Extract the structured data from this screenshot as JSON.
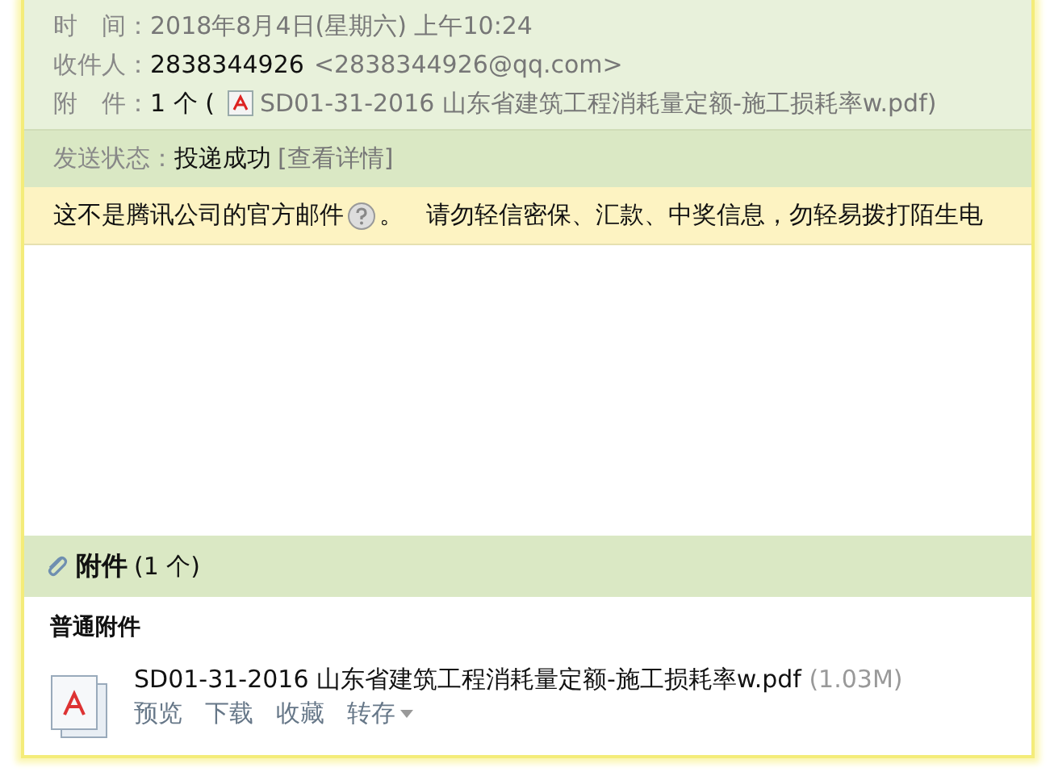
{
  "header": {
    "fields": [
      {
        "label": "时　间：",
        "value": "2018年8月4日(星期六) 上午10:24",
        "kind": "time"
      },
      {
        "label": "收件人：",
        "value": "2838344926",
        "address": "<2838344926@qq.com>",
        "kind": "recipient"
      },
      {
        "label": "附　件：",
        "value": "1 个 (",
        "file": "SD01-31-2016 山东省建筑工程消耗量定额-施工损耗率w.pdf)",
        "kind": "attachment"
      }
    ]
  },
  "status": {
    "label": "发送状态：",
    "value": "投递成功",
    "link": "[查看详情]"
  },
  "warning": {
    "text": "这不是腾讯公司的官方邮件",
    "suffix": "。",
    "message": "请勿轻信密保、汇款、中奖信息，勿轻易拨打陌生电"
  },
  "attachments": {
    "title": "附件",
    "count": "(1 个)",
    "group": "普通附件",
    "files": [
      {
        "name": "SD01-31-2016 山东省建筑工程消耗量定额-施工损耗率w.pdf",
        "size": "(1.03M)",
        "actions": [
          "预览",
          "下载",
          "收藏",
          "转存"
        ]
      }
    ]
  }
}
